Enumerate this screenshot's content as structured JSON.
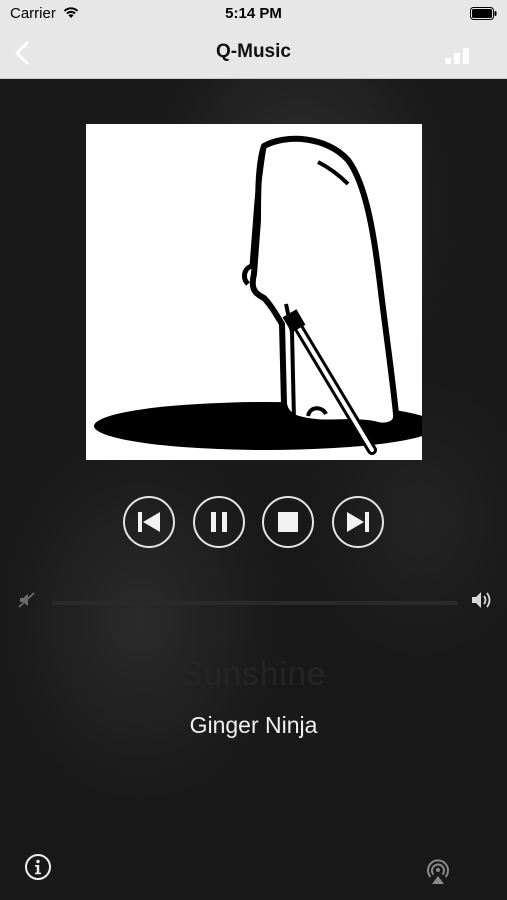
{
  "status_bar": {
    "carrier": "Carrier",
    "time": "5:14 PM"
  },
  "nav": {
    "title": "Q-Music"
  },
  "now_playing": {
    "title": "Sunshine",
    "artist": "Ginger Ninja"
  },
  "playback": {
    "state": "playing",
    "volume": 0
  },
  "colors": {
    "bars": "#e7e7e7",
    "background": "#191919",
    "control_ring": "#e5e5e5"
  },
  "icons": [
    "wifi-icon",
    "battery-icon",
    "back-icon",
    "signal-icon",
    "previous-icon",
    "pause-icon",
    "stop-icon",
    "next-icon",
    "volume-mute-icon",
    "volume-up-icon",
    "info-icon",
    "airplay-icon"
  ]
}
